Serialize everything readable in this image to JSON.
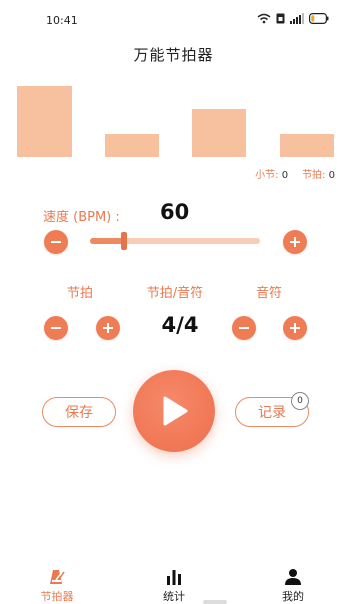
{
  "status_bar": {
    "time": "10:41",
    "icons": [
      "wifi-icon",
      "sim-icon",
      "signal-icon",
      "battery-icon"
    ]
  },
  "title": "万能节拍器",
  "beat_bars": {
    "accent_color": "#f7c09e",
    "levels": [
      0.82,
      0.27,
      0.55,
      0.27
    ]
  },
  "counters": {
    "bar_label": "小节:",
    "bar_value": "0",
    "beat_label": "节拍:",
    "beat_value": "0"
  },
  "tempo": {
    "label": "速度 (BPM) :",
    "value": "60",
    "slider_fraction": 0.2,
    "minus_icon": "minus-icon",
    "plus_icon": "plus-icon"
  },
  "meter": {
    "beats_label": "节拍",
    "beat_note_label": "节拍/音符",
    "note_label": "音符",
    "time_signature": "4/4"
  },
  "actions": {
    "save_label": "保存",
    "record_label": "记录",
    "record_badge": "0",
    "play_icon": "play-icon"
  },
  "tabs": [
    {
      "label": "节拍器",
      "icon": "metronome-icon",
      "active": true
    },
    {
      "label": "统计",
      "icon": "bar-chart-icon",
      "active": false
    },
    {
      "label": "我的",
      "icon": "user-icon",
      "active": false
    }
  ],
  "colors": {
    "accent": "#ee7d55",
    "accent_light": "#f8cdb5",
    "text_accent": "#e97a50"
  }
}
